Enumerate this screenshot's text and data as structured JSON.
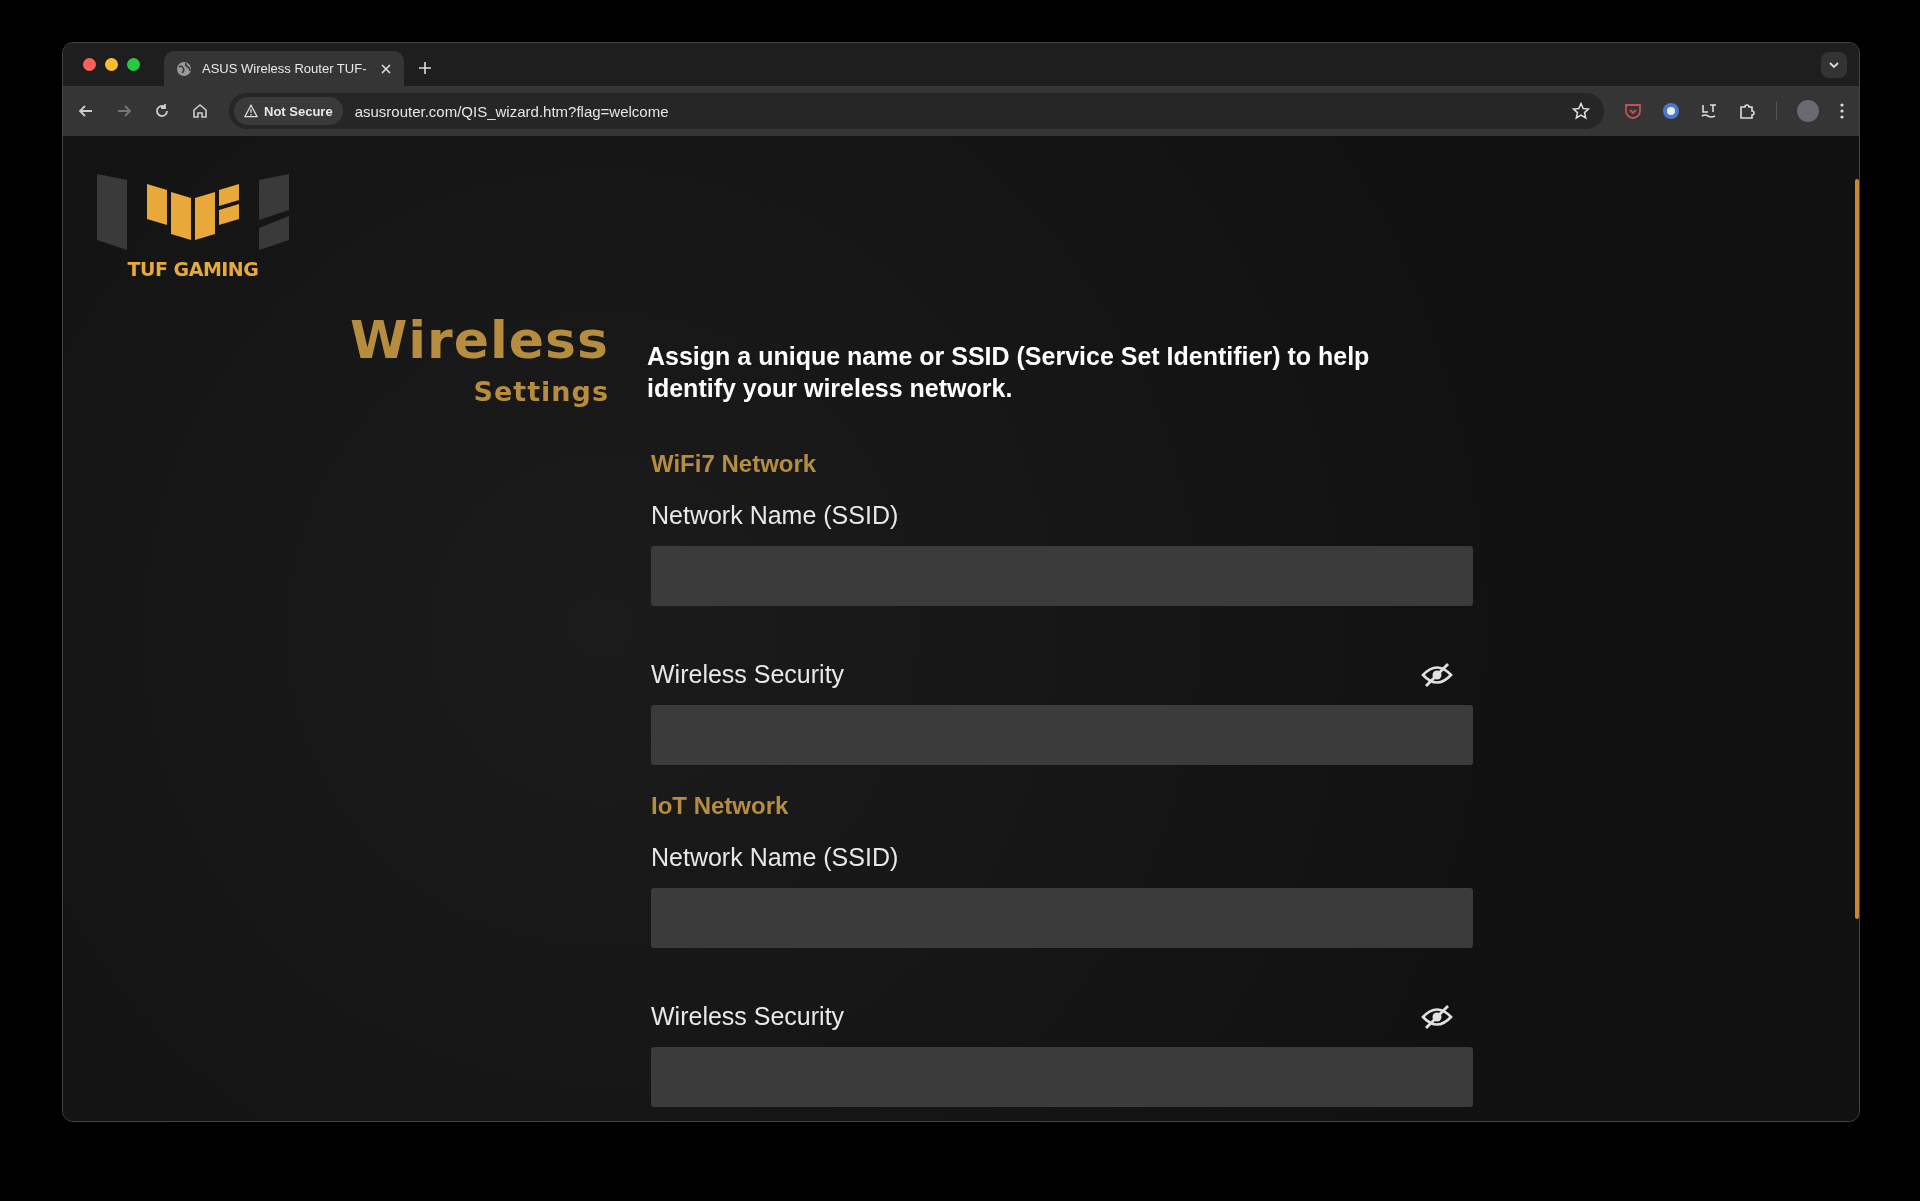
{
  "browser": {
    "tab": {
      "title": "ASUS Wireless Router TUF-"
    },
    "address": {
      "security": "Not Secure",
      "url": "asusrouter.com/QIS_wizard.htm?flag=welcome"
    }
  },
  "page": {
    "logo_text": "TUF GAMING",
    "heading": "Wireless",
    "subheading": "Settings",
    "description": "Assign a unique name or SSID (Service Set Identifier) to help identify your wireless network.",
    "sections": [
      {
        "title": "WiFi7 Network",
        "fields": [
          {
            "label": "Network Name (SSID)",
            "kind": "text"
          },
          {
            "label": "Wireless Security",
            "kind": "password"
          }
        ]
      },
      {
        "title": "IoT Network",
        "fields": [
          {
            "label": "Network Name (SSID)",
            "kind": "text"
          },
          {
            "label": "Wireless Security",
            "kind": "password"
          }
        ]
      }
    ]
  }
}
